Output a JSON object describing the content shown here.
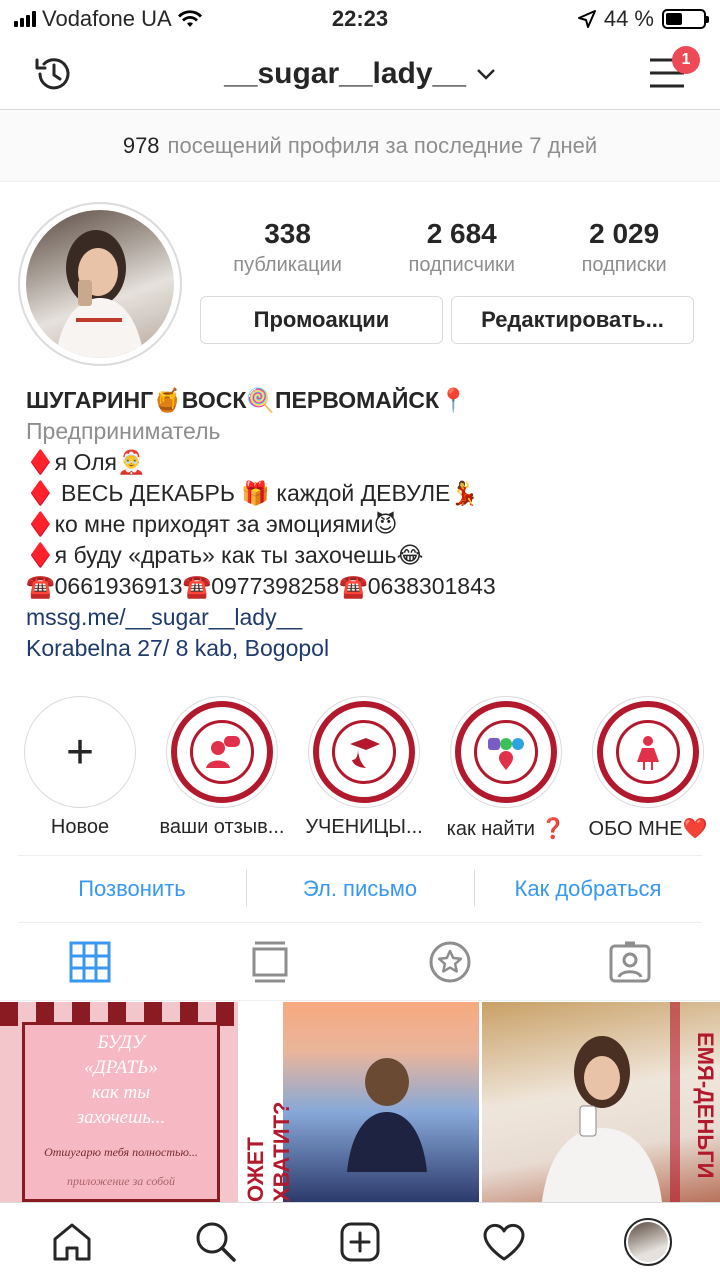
{
  "status": {
    "carrier": "Vodafone UA",
    "time": "22:23",
    "battery": "44 %"
  },
  "header": {
    "username": "__sugar__lady__",
    "notification_count": "1"
  },
  "visits": {
    "count": "978",
    "text": "посещений профиля за последние 7 дней"
  },
  "profile": {
    "stats": [
      {
        "value": "338",
        "label": "публикации"
      },
      {
        "value": "2 684",
        "label": "подписчики"
      },
      {
        "value": "2 029",
        "label": "подписки"
      }
    ],
    "promo_button": "Промоакции",
    "edit_button": "Редактировать..."
  },
  "bio": {
    "name": "ШУГАРИНГ🍯ВОСК🍭ПЕРВОМАЙСК📍",
    "category": "Предприниматель",
    "lines": [
      "♦️я Оля🤶",
      "♦️ ВЕСЬ ДЕКАБРЬ 🎁 каждой ДЕВУЛЕ💃",
      "♦️ко мне приходят за эмоциями😈",
      "♦️я буду «драть» как ты захочешь😂",
      "☎️0661936913☎️0977398258☎️0638301843"
    ],
    "link": "mssg.me/__sugar__lady__",
    "address": "Korabelna 27/ 8 kab, Bogopol"
  },
  "highlights": [
    {
      "label": "Новое",
      "icon": "plus-icon"
    },
    {
      "label": "ваши отзыв...",
      "icon": "chat-user-icon"
    },
    {
      "label": "УЧЕНИЦЫ...",
      "icon": "graduate-icon"
    },
    {
      "label": "как найти ❓",
      "icon": "messenger-location-icon"
    },
    {
      "label": "ОБО МНЕ❤️",
      "icon": "woman-icon"
    }
  ],
  "contact": {
    "call": "Позвонить",
    "email": "Эл. письмо",
    "directions": "Как добраться"
  },
  "grid": {
    "post1_lines": [
      "БУДУ",
      "«ДРАТЬ»",
      "как ты",
      "захочешь..."
    ],
    "post1_sub": "Отшугарю тебя полностью...",
    "post1_sub2": "приложение за собой",
    "post2_text": "ОЖЕТ ХВАТИТ?",
    "post3_text": "ЕМЯ-ДЕНЬГИ"
  },
  "colors": {
    "link_blue": "#3897f0",
    "badge_red": "#ed4956",
    "brand_red": "#b3192d"
  }
}
